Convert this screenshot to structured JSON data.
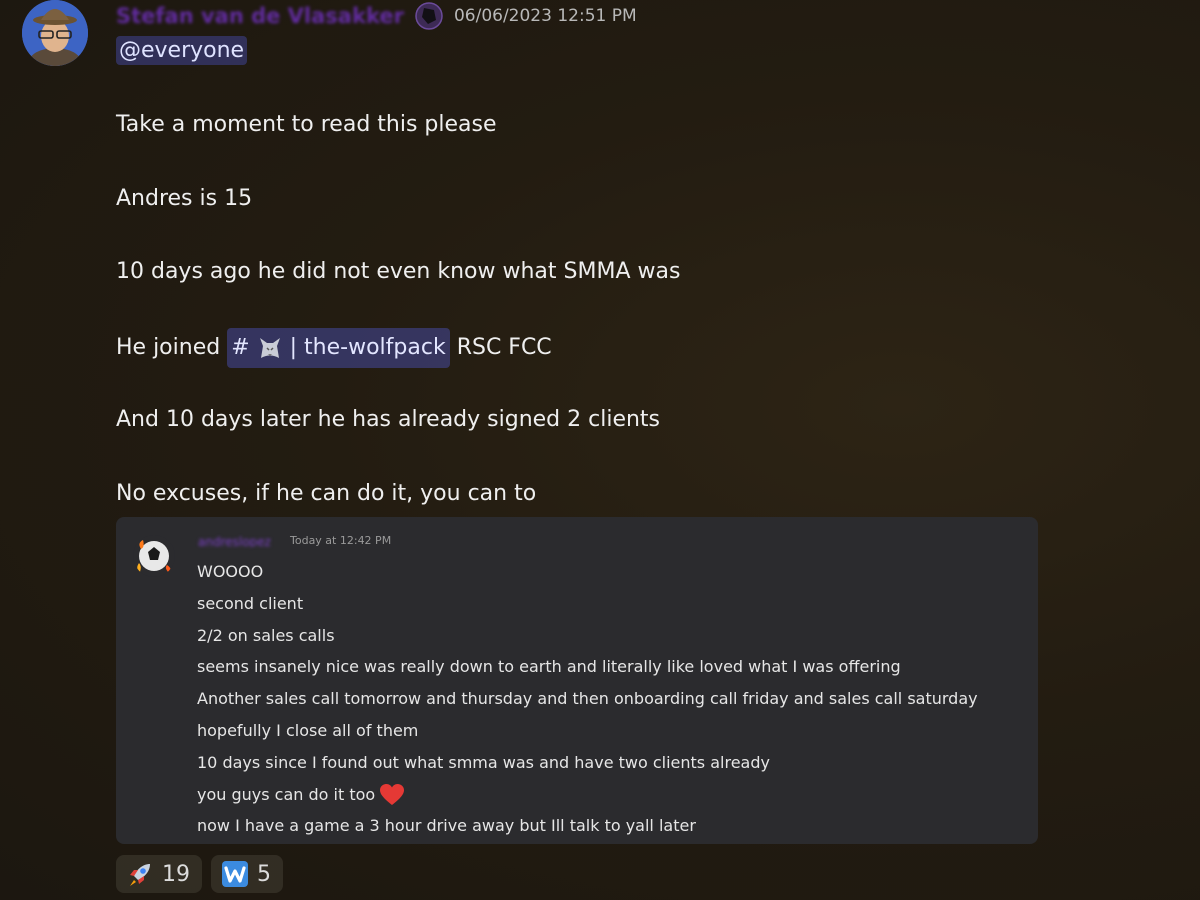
{
  "message": {
    "author": "Stefan van de Vlasakker",
    "timestamp": "06/06/2023 12:51 PM",
    "mention": "@everyone",
    "lines": [
      "Take a moment to read this please",
      "Andres is 15",
      "10 days ago he did not even know what SMMA was",
      "And 10 days later he has already signed 2 clients",
      "No excuses, if he can do it, you can to"
    ],
    "joined": {
      "prefix": "He joined",
      "channel_hash": "#",
      "channel_name": "| the-wolfpack",
      "suffix": "RSC FCC"
    }
  },
  "embed": {
    "author": "andreslopez",
    "time": "Today at 12:42 PM",
    "lines": [
      "WOOOO",
      "second client",
      "2/2 on sales calls",
      "seems insanely nice was really down to earth and literally like loved what I was offering",
      "Another sales call tomorrow and thursday and then onboarding call friday and sales call saturday",
      "hopefully I close all of them",
      "10 days since I found out what smma was and have two clients already",
      "you guys can do it too",
      "now I have a game a 3 hour drive away but Ill talk to yall later"
    ]
  },
  "reactions": [
    {
      "emoji": "rocket-icon",
      "count": "19"
    },
    {
      "emoji": "w-letter-icon",
      "count": "5"
    }
  ],
  "colors": {
    "background": "#231c11",
    "author": "#6d2fb8",
    "mention_bg": "#5865f2",
    "embed_bg": "#2b2b2e",
    "heart": "#e53935"
  }
}
